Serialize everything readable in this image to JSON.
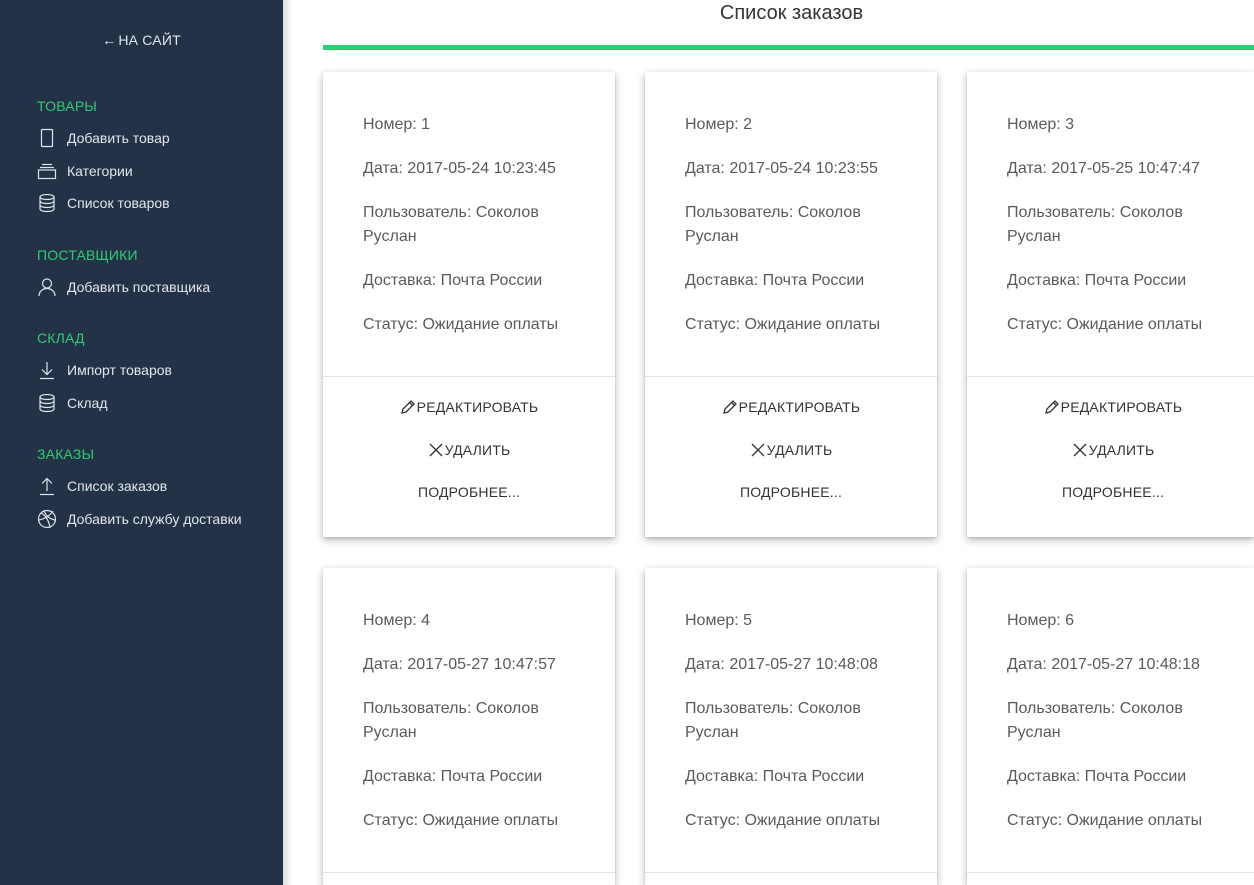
{
  "sidebar": {
    "back_link": "НА САЙТ",
    "sections": [
      {
        "title": "ТОВАРЫ",
        "items": [
          {
            "label": "Добавить товар",
            "icon": "tablet-icon"
          },
          {
            "label": "Категории",
            "icon": "stack-icon"
          },
          {
            "label": "Список товаров",
            "icon": "database-icon"
          }
        ]
      },
      {
        "title": "ПОСТАВЩИКИ",
        "items": [
          {
            "label": "Добавить поставщика",
            "icon": "user-icon"
          }
        ]
      },
      {
        "title": "СКЛАД",
        "items": [
          {
            "label": "Импорт товаров",
            "icon": "download-icon"
          },
          {
            "label": "Склад",
            "icon": "database-icon"
          }
        ]
      },
      {
        "title": "ЗАКАЗЫ",
        "items": [
          {
            "label": "Список заказов",
            "icon": "upload-icon"
          },
          {
            "label": "Добавить службу доставки",
            "icon": "globe-icon"
          }
        ]
      }
    ]
  },
  "main": {
    "title": "Список заказов",
    "accent_color": "#2ecc71",
    "orders": [
      {
        "number": "Номер: 1",
        "date": "Дата: 2017-05-24 10:23:45",
        "user": "Пользователь: Соколов Руслан",
        "delivery": "Доставка: Почта России",
        "status": "Статус: Ожидание оплаты"
      },
      {
        "number": "Номер: 2",
        "date": "Дата: 2017-05-24 10:23:55",
        "user": "Пользователь: Соколов Руслан",
        "delivery": "Доставка: Почта России",
        "status": "Статус: Ожидание оплаты"
      },
      {
        "number": "Номер: 3",
        "date": "Дата: 2017-05-25 10:47:47",
        "user": "Пользователь: Соколов Руслан",
        "delivery": "Доставка: Почта России",
        "status": "Статус: Ожидание оплаты"
      },
      {
        "number": "Номер: 4",
        "date": "Дата: 2017-05-27 10:47:57",
        "user": "Пользователь: Соколов Руслан",
        "delivery": "Доставка: Почта России",
        "status": "Статус: Ожидание оплаты"
      },
      {
        "number": "Номер: 5",
        "date": "Дата: 2017-05-27 10:48:08",
        "user": "Пользователь: Соколов Руслан",
        "delivery": "Доставка: Почта России",
        "status": "Статус: Ожидание оплаты"
      },
      {
        "number": "Номер: 6",
        "date": "Дата: 2017-05-27 10:48:18",
        "user": "Пользователь: Соколов Руслан",
        "delivery": "Доставка: Почта России",
        "status": "Статус: Ожидание оплаты"
      }
    ],
    "actions": {
      "edit": "РЕДАКТИРОВАТЬ",
      "delete": "УДАЛИТЬ",
      "details": "ПОДРОБНЕЕ..."
    }
  }
}
